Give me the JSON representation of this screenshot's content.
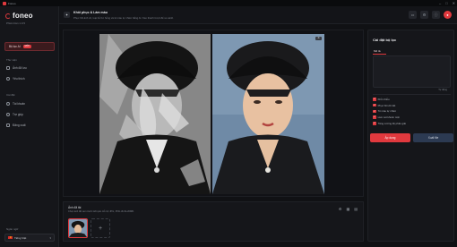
{
  "window": {
    "title": "Foneo"
  },
  "sidebar": {
    "brand": "foneo",
    "subtitle": "Phiên bản 1.0.5",
    "active_item": {
      "label": "Bộ lọc AI",
      "badge": "MỚI"
    },
    "section_library": "Thư viện",
    "items_library": [
      {
        "label": "Ảnh đã lưu",
        "icon": "image-icon"
      },
      {
        "label": "Yêu thích",
        "icon": "heart-icon"
      }
    ],
    "section_settings": "Cài đặt",
    "items_settings": [
      {
        "label": "Tài khoản",
        "icon": "user-icon"
      },
      {
        "label": "Trợ giúp",
        "icon": "help-icon"
      },
      {
        "label": "Đăng xuất",
        "icon": "logout-icon"
      }
    ],
    "language_label": "Ngôn ngữ",
    "language_value": "Tiếng Việt"
  },
  "header": {
    "title": "Khôi phục & Làm màu",
    "subtitle": "Phục hồi ảnh cũ, loại bỏ hư hỏng và tô màu tự nhiên bằng AI. Kéo thanh trượt để so sánh."
  },
  "thumbnails": {
    "title": "Ảnh đã tải",
    "subtitle": "Chọn ảnh để xem trước kết quả. Hỗ trợ JPG, PNG tối đa 20MB.",
    "add_symbol": "+"
  },
  "panel": {
    "title": "Cài đặt bộ lọc",
    "tab_label": "Mô tả",
    "field_value": "Tự động",
    "options": [
      "Khử nhiễu",
      "Phục hồi chi tiết",
      "Tô màu tự nhiên",
      "Làm nét khuôn mặt",
      "Tăng cường độ phân giải"
    ],
    "apply_label": "Áp dụng",
    "export_label": "Xuất file"
  },
  "colors": {
    "accent": "#e0393e",
    "background": "#101114",
    "panel": "#15161a"
  }
}
